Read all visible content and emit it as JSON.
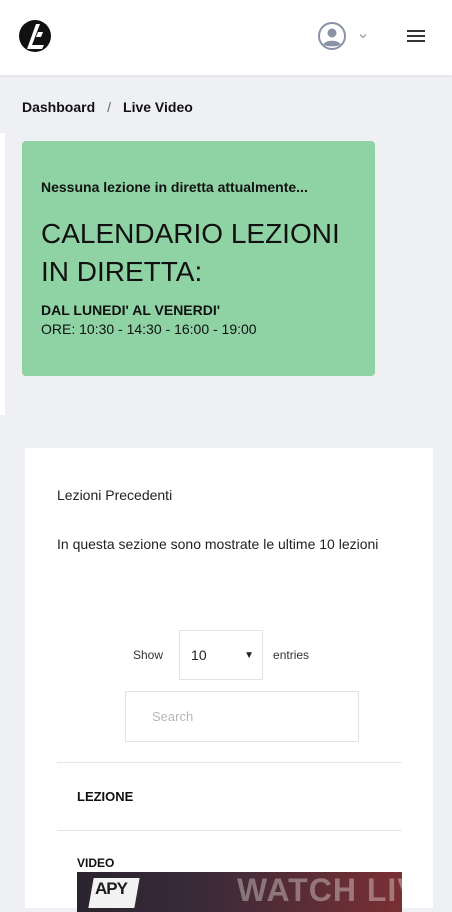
{
  "header": {
    "logo_icon": "brand-logo-icon",
    "user_icon": "user-avatar-icon",
    "dropdown_icon": "chevron-down-icon",
    "menu_icon": "hamburger-menu-icon"
  },
  "breadcrumb": {
    "items": [
      "Dashboard",
      "Live Video"
    ],
    "separator": "/"
  },
  "live_card": {
    "status": "Nessuna lezione in diretta attualmente...",
    "calendar_title": "CALENDARIO LEZIONI IN DIRETTA:",
    "days": "DAL LUNEDI' AL VENERDI'",
    "hours": "ORE: 10:30 - 14:30 - 16:00 - 19:00",
    "bg_color": "#8fd3a5"
  },
  "previous": {
    "title": "Lezioni Precedenti",
    "description": "In questa sezione sono mostrate le ultime 10 lezioni",
    "show_label": "Show",
    "entries_value": "10",
    "entries_label": "entries",
    "search_placeholder": "Search",
    "column_header": "LEZIONE",
    "video_label": "VIDEO",
    "thumb_logo_text": "APY",
    "thumb_text": "WATCH LIVE"
  }
}
